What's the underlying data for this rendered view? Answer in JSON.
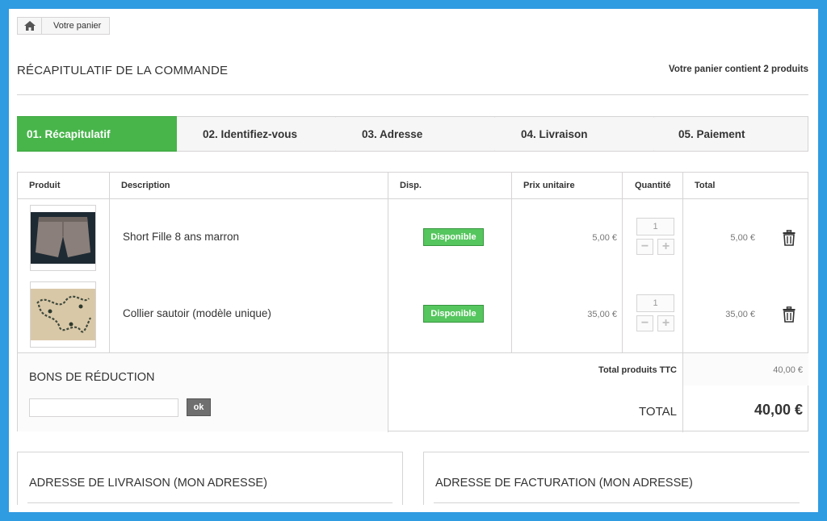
{
  "breadcrumb": {
    "home_icon": "home-icon",
    "current": "Votre panier"
  },
  "heading": {
    "title": "RÉCAPITULATIF DE LA COMMANDE",
    "cart_count": "Votre panier contient 2 produits"
  },
  "steps": [
    {
      "label": "01. Récapitulatif",
      "active": true
    },
    {
      "label": "02. Identifiez-vous",
      "active": false
    },
    {
      "label": "03. Adresse",
      "active": false
    },
    {
      "label": "04. Livraison",
      "active": false
    },
    {
      "label": "05. Paiement",
      "active": false
    }
  ],
  "colors": {
    "active_step": "#48b54b",
    "available_badge": "#55c65e",
    "frame": "#2f9be0"
  },
  "table": {
    "headers": {
      "product": "Produit",
      "description": "Description",
      "availability": "Disp.",
      "unit_price": "Prix unitaire",
      "quantity": "Quantité",
      "total": "Total"
    },
    "rows": [
      {
        "description": "Short Fille 8 ans marron",
        "availability": "Disponible",
        "unit_price": "5,00 €",
        "quantity": "1",
        "total": "5,00 €",
        "icon": "trash-icon"
      },
      {
        "description": "Collier sautoir (modèle unique)",
        "availability": "Disponible",
        "unit_price": "35,00 €",
        "quantity": "1",
        "total": "35,00 €",
        "icon": "trash-icon"
      }
    ],
    "qty_minus": "−",
    "qty_plus": "+"
  },
  "discount": {
    "title": "BONS DE RÉDUCTION",
    "input_value": "",
    "button": "ok"
  },
  "totals": {
    "products_label": "Total produits TTC",
    "products_value": "40,00 €",
    "total_label": "TOTAL",
    "total_value": "40,00 €"
  },
  "addresses": {
    "delivery_title": "ADRESSE DE LIVRAISON (MON ADRESSE)",
    "billing_title": "ADRESSE DE FACTURATION (MON ADRESSE)"
  }
}
